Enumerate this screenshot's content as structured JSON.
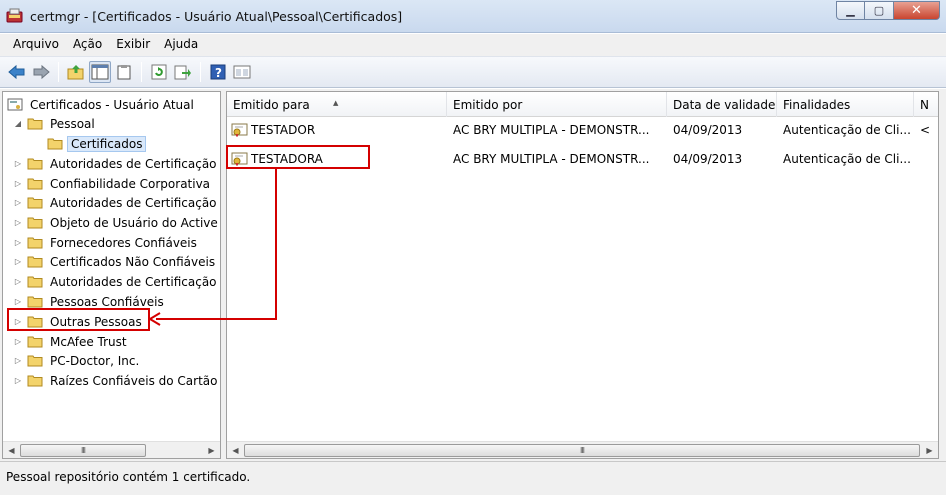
{
  "window": {
    "title": "certmgr - [Certificados - Usuário Atual\\Pessoal\\Certificados]",
    "minimize_glyph": "▁",
    "maximize_glyph": "▢",
    "close_glyph": "✕"
  },
  "menu": [
    "Arquivo",
    "Ação",
    "Exibir",
    "Ajuda"
  ],
  "toolbar": {
    "icons": [
      "back-arrow-icon",
      "forward-arrow-icon",
      "up-folder-icon",
      "show-hide-tree-icon",
      "clipboard-icon",
      "refresh-icon",
      "export-list-icon",
      "help-icon",
      "properties-icon"
    ]
  },
  "tree": {
    "root": "Certificados - Usuário Atual",
    "items": [
      {
        "label": "Pessoal",
        "expanded": true
      },
      {
        "label": "Certificados",
        "selected": true
      },
      {
        "label": "Autoridades de Certificação F"
      },
      {
        "label": "Confiabilidade Corporativa"
      },
      {
        "label": "Autoridades de Certificação I"
      },
      {
        "label": "Objeto de Usuário do Active I"
      },
      {
        "label": "Fornecedores Confiáveis"
      },
      {
        "label": "Certificados Não Confiáveis"
      },
      {
        "label": "Autoridades de Certificação F"
      },
      {
        "label": "Pessoas Confiáveis"
      },
      {
        "label": "Outras Pessoas"
      },
      {
        "label": "McAfee Trust"
      },
      {
        "label": "PC-Doctor, Inc."
      },
      {
        "label": "Raízes Confiáveis do Cartão I"
      }
    ],
    "scroll_glyph": "III"
  },
  "list": {
    "columns": [
      "Emitido para",
      "Emitido por",
      "Data de validade",
      "Finalidades",
      "N"
    ],
    "rows": [
      {
        "issued_to": "TESTADOR",
        "issued_by": "AC BRY MULTIPLA - DEMONSTR...",
        "expires": "04/09/2013",
        "purposes": "Autenticação de Cli...",
        "extra": "<"
      },
      {
        "issued_to": "TESTADORA",
        "issued_by": "AC BRY MULTIPLA - DEMONSTR...",
        "expires": "04/09/2013",
        "purposes": "Autenticação de Cli...",
        "extra": ""
      }
    ],
    "scroll_glyph": "III"
  },
  "status": "Pessoal repositório contém 1 certificado.",
  "colors": {
    "annotation_red": "#d40000",
    "folder_yellow": "#f3d36b",
    "selection_blue": "#d9e8fa"
  }
}
